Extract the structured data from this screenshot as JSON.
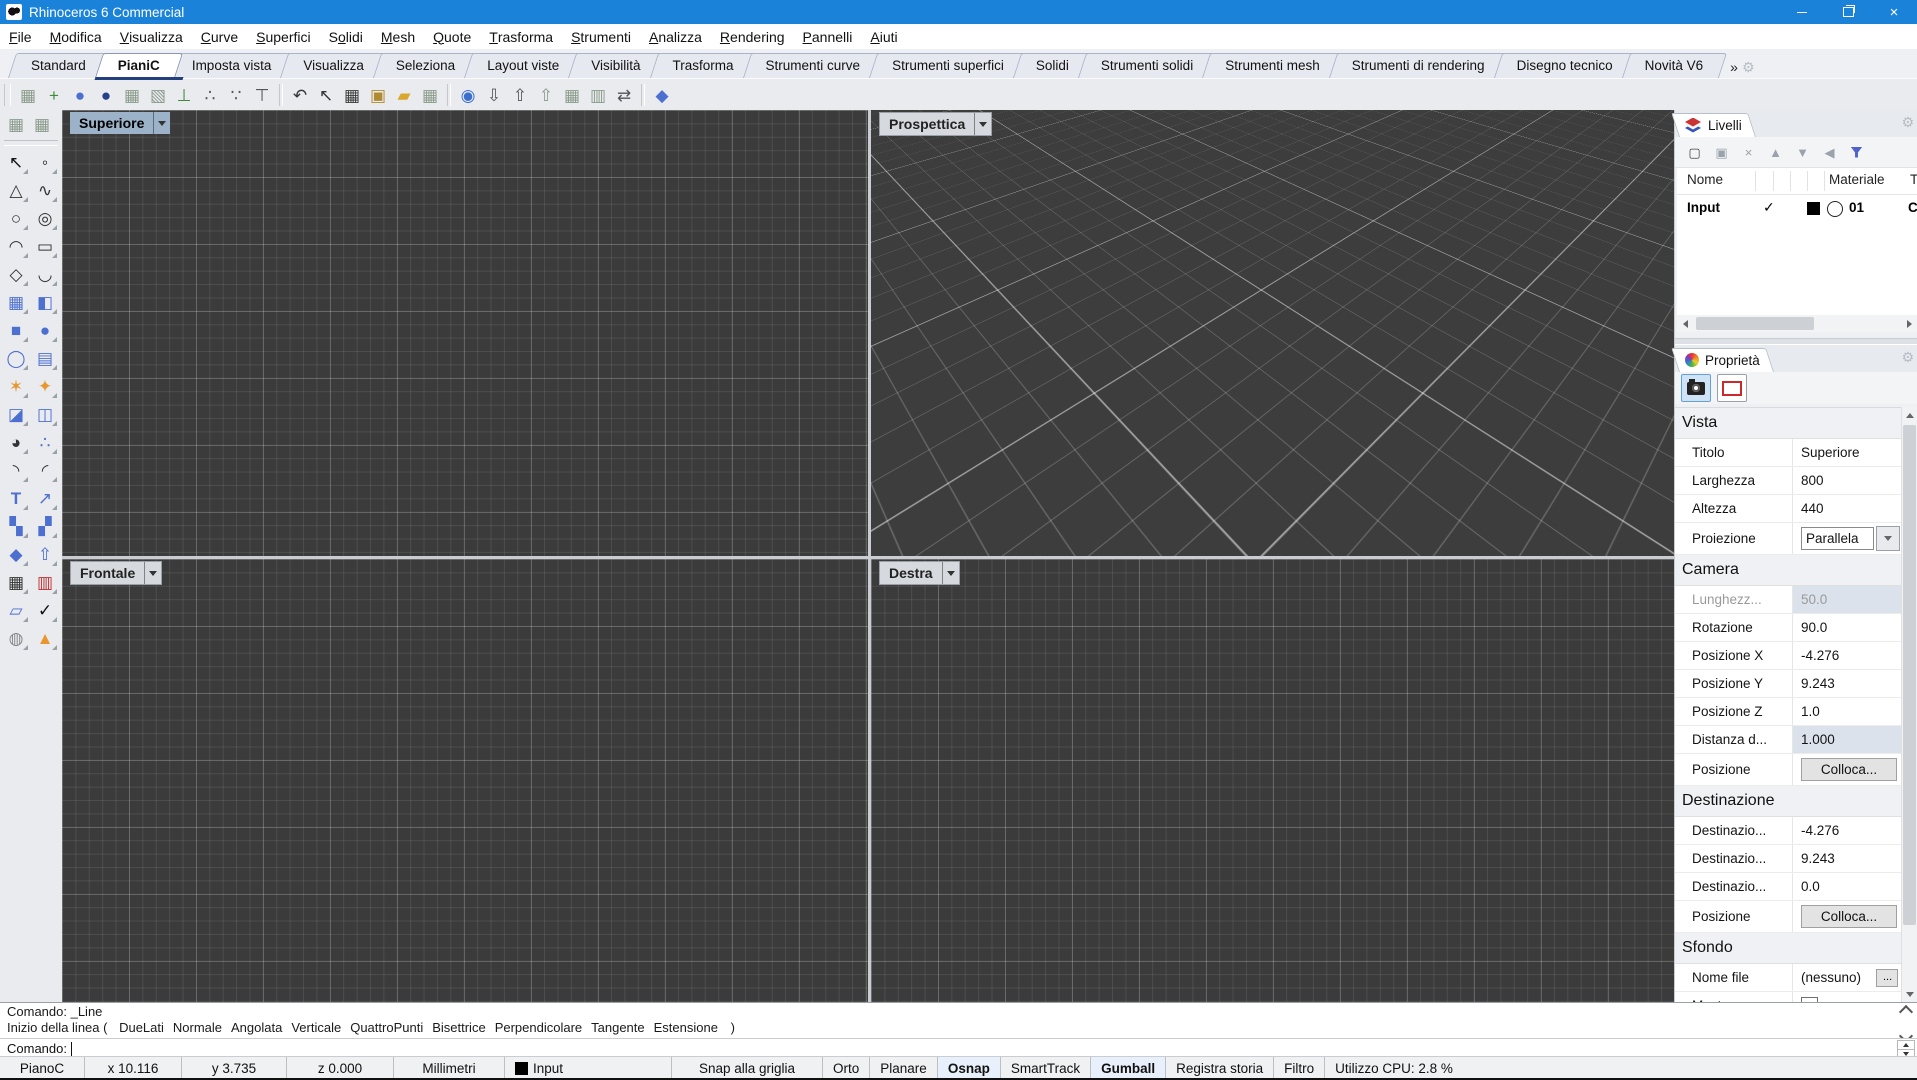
{
  "colors": {
    "titlebar": "#1a83d9",
    "viewport_bg": "#3b3b3b",
    "active_viewport_label": "#9cb2c8",
    "accent_filter": "#4e62c9"
  },
  "window": {
    "title": "Rhinoceros 6 Commercial"
  },
  "menu": {
    "items": [
      {
        "pre": "",
        "key": "F",
        "post": "ile"
      },
      {
        "pre": "",
        "key": "M",
        "post": "odifica"
      },
      {
        "pre": "",
        "key": "V",
        "post": "isualizza"
      },
      {
        "pre": "",
        "key": "C",
        "post": "urve"
      },
      {
        "pre": "",
        "key": "S",
        "post": "uperfici"
      },
      {
        "pre": "S",
        "key": "o",
        "post": "lidi"
      },
      {
        "pre": "",
        "key": "M",
        "post": "esh"
      },
      {
        "pre": "",
        "key": "Q",
        "post": "uote"
      },
      {
        "pre": "",
        "key": "T",
        "post": "rasforma"
      },
      {
        "pre": "",
        "key": "S",
        "post": "trumenti"
      },
      {
        "pre": "",
        "key": "A",
        "post": "nalizza"
      },
      {
        "pre": "",
        "key": "R",
        "post": "endering"
      },
      {
        "pre": "",
        "key": "P",
        "post": "annelli"
      },
      {
        "pre": "",
        "key": "A",
        "post": "iuti"
      }
    ]
  },
  "tabs": {
    "active": "PianiC",
    "overflow": "»",
    "items": [
      "Standard",
      "PianiC",
      "Imposta vista",
      "Visualizza",
      "Seleziona",
      "Layout viste",
      "Visibilità",
      "Trasforma",
      "Strumenti curve",
      "Strumenti superfici",
      "Solidi",
      "Strumenti solidi",
      "Strumenti mesh",
      "Strumenti di rendering",
      "Disegno tecnico",
      "Novità V6"
    ]
  },
  "toolbar": {
    "items": [
      {
        "n": "cplane-world-icon",
        "g": "▦",
        "c": "#8a9a8a"
      },
      {
        "n": "cplane-origin-icon",
        "g": "+",
        "c": "#3f8a3f"
      },
      {
        "n": "cplane-sphere-icon",
        "g": "●",
        "c": "#4d6fd0"
      },
      {
        "n": "cplane-sphere-dark-icon",
        "g": "●",
        "c": "#27408b"
      },
      {
        "n": "cplane-object-icon",
        "g": "▦",
        "c": "#8a9a8a"
      },
      {
        "n": "cplane-rotate-icon",
        "g": "▧",
        "c": "#8a9a8a"
      },
      {
        "n": "cplane-zaxis-icon",
        "g": "⊥",
        "c": "#3f8a3f"
      },
      {
        "n": "cplane-3point-icon",
        "g": "∴",
        "c": "#555555"
      },
      {
        "n": "cplane-points-icon",
        "g": "∵",
        "c": "#555555"
      },
      {
        "n": "cplane-elevation-icon",
        "g": "⊤",
        "c": "#555555"
      },
      {
        "sep": true
      },
      {
        "n": "undo-cplane-icon",
        "g": "↶",
        "c": "#333333"
      },
      {
        "n": "select-cursor-icon",
        "g": "↖",
        "c": "#333333"
      },
      {
        "n": "grid-settings-icon",
        "g": "▦",
        "c": "#3a3a3a"
      },
      {
        "n": "save-cplane-icon",
        "g": "▣",
        "c": "#b08a30"
      },
      {
        "n": "open-folder-icon",
        "g": "▰",
        "c": "#d9a62e"
      },
      {
        "n": "cplane-import-icon",
        "g": "▦",
        "c": "#8a9a8a"
      },
      {
        "sep": true
      },
      {
        "n": "show-eye-icon",
        "g": "◉",
        "c": "#3a6fd0"
      },
      {
        "n": "cplane-down-icon",
        "g": "⇩",
        "c": "#555555"
      },
      {
        "n": "cplane-up-icon",
        "g": "⇧",
        "c": "#555555"
      },
      {
        "n": "cplane-raise-icon",
        "g": "⇧",
        "c": "#8a9a8a"
      },
      {
        "n": "cplane-next-icon",
        "g": "▦",
        "c": "#8a9a8a"
      },
      {
        "n": "cplane-previous-icon",
        "g": "▥",
        "c": "#8a9a8a"
      },
      {
        "n": "cplane-swap-icon",
        "g": "⇄",
        "c": "#555555"
      },
      {
        "sep": true
      },
      {
        "n": "polyhedron-icon",
        "g": "◆",
        "c": "#4d6fd0"
      }
    ]
  },
  "sidebar": {
    "top": [
      {
        "n": "cplane-dock-icon-1",
        "g": "▦",
        "c": "#8a9a8a"
      },
      {
        "n": "cplane-dock-icon-2",
        "g": "▦",
        "c": "#8a9a8a"
      }
    ],
    "items": [
      {
        "n": "select-arrow-icon",
        "g": "↖",
        "c": "#111111"
      },
      {
        "n": "point-icon",
        "g": "◦",
        "c": "#111111"
      },
      {
        "n": "control-point-curve-icon",
        "g": "△",
        "c": "#333333"
      },
      {
        "n": "curve-icon",
        "g": "∿",
        "c": "#333333"
      },
      {
        "n": "circle-icon",
        "g": "○",
        "c": "#333333"
      },
      {
        "n": "ellipse-icon",
        "g": "◎",
        "c": "#333333"
      },
      {
        "n": "arc-icon",
        "g": "◠",
        "c": "#333333"
      },
      {
        "n": "rectangle-icon",
        "g": "▭",
        "c": "#333333"
      },
      {
        "n": "polygon-icon",
        "g": "◇",
        "c": "#333333"
      },
      {
        "n": "fillet-curve-icon",
        "g": "◡",
        "c": "#333333"
      },
      {
        "n": "surface-points-icon",
        "g": "▦",
        "c": "#4d6fd0"
      },
      {
        "n": "loft-surface-icon",
        "g": "◧",
        "c": "#4d6fd0"
      },
      {
        "n": "box-icon",
        "g": "■",
        "c": "#4d6fd0"
      },
      {
        "n": "sphere-icon",
        "g": "●",
        "c": "#4d6fd0"
      },
      {
        "n": "torus-icon",
        "g": "◯",
        "c": "#4d6fd0"
      },
      {
        "n": "surface-grid-icon",
        "g": "▤",
        "c": "#4d6fd0"
      },
      {
        "n": "explode-icon",
        "g": "✶",
        "c": "#e8962e"
      },
      {
        "n": "boom-icon",
        "g": "✦",
        "c": "#e8962e"
      },
      {
        "n": "trim-icon",
        "g": "◪",
        "c": "#4d6fd0"
      },
      {
        "n": "split-icon",
        "g": "◫",
        "c": "#4d6fd0"
      },
      {
        "n": "blend-colors-icon",
        "g": "◕",
        "c": "#333333"
      },
      {
        "n": "point-group-icon",
        "g": "∴",
        "c": "#4d6fd0"
      },
      {
        "n": "fillet-icon",
        "g": "◝",
        "c": "#333333"
      },
      {
        "n": "blend-curve-icon",
        "g": "◜",
        "c": "#333333"
      },
      {
        "n": "text-icon",
        "g": "T",
        "c": "#4d6fd0"
      },
      {
        "n": "scale-icon",
        "g": "↗",
        "c": "#4d6fd0"
      },
      {
        "n": "arrange-icon",
        "g": "▚",
        "c": "#4d6fd0"
      },
      {
        "n": "rotate-rect-icon",
        "g": "▞",
        "c": "#4d6fd0"
      },
      {
        "n": "solid-union-icon",
        "g": "◆",
        "c": "#4d6fd0"
      },
      {
        "n": "extrude-icon",
        "g": "⇧",
        "c": "#4d6fd0"
      },
      {
        "n": "array-grid-icon",
        "g": "▦",
        "c": "#333333"
      },
      {
        "n": "distribute-icon",
        "g": "▥",
        "c": "#c03030"
      },
      {
        "n": "layout-icon",
        "g": "▱",
        "c": "#4d6fd0"
      },
      {
        "n": "check-icon",
        "g": "✓",
        "c": "#111111"
      },
      {
        "n": "cylinder-cone-icon",
        "g": "◍",
        "c": "#888888"
      },
      {
        "n": "cone-icon",
        "g": "▲",
        "c": "#e8962e"
      }
    ]
  },
  "viewports": {
    "top_left": {
      "label": "Superiore",
      "active": true
    },
    "top_right": {
      "label": "Prospettica",
      "active": false
    },
    "bottom_left": {
      "label": "Frontale",
      "active": false
    },
    "bottom_right": {
      "label": "Destra",
      "active": false
    }
  },
  "layers": {
    "title": "Livelli",
    "toolbar": [
      {
        "n": "new-layer-icon",
        "g": "▢",
        "c": "#444444"
      },
      {
        "n": "copy-layer-icon",
        "g": "▣",
        "c": "#9aa2ac"
      },
      {
        "n": "delete-layer-icon",
        "g": "×",
        "c": "#9aa2ac"
      },
      {
        "n": "layer-up-icon",
        "g": "▲",
        "c": "#9aa2ac"
      },
      {
        "n": "layer-down-icon",
        "g": "▼",
        "c": "#9aa2ac"
      },
      {
        "n": "layer-left-icon",
        "g": "◀",
        "c": "#9aa2ac"
      }
    ],
    "columns": [
      "Nome",
      "Materiale",
      "T"
    ],
    "row": {
      "name": "Input",
      "current_mark": "✓",
      "color": "#000000",
      "material": "01",
      "linetype_clipped": "C"
    }
  },
  "properties": {
    "title": "Proprietà",
    "sections": [
      {
        "header": "Vista",
        "rows": [
          {
            "label": "Titolo",
            "value": "Superiore"
          },
          {
            "label": "Larghezza",
            "value": "800"
          },
          {
            "label": "Altezza",
            "value": "440"
          },
          {
            "label": "Proiezione",
            "value": "Parallela",
            "type": "dropdown"
          }
        ]
      },
      {
        "header": "Camera",
        "rows": [
          {
            "label": "Lunghezz...",
            "value": "50.0",
            "disabled": true,
            "shaded": true
          },
          {
            "label": "Rotazione",
            "value": "90.0"
          },
          {
            "label": "Posizione X",
            "value": "-4.276"
          },
          {
            "label": "Posizione Y",
            "value": "9.243"
          },
          {
            "label": "Posizione Z",
            "value": "1.0"
          },
          {
            "label": "Distanza d...",
            "value": "1.000",
            "shaded": true
          },
          {
            "label": "Posizione",
            "value": "Colloca...",
            "type": "button"
          }
        ]
      },
      {
        "header": "Destinazione",
        "rows": [
          {
            "label": "Destinazio...",
            "value": "-4.276"
          },
          {
            "label": "Destinazio...",
            "value": "9.243"
          },
          {
            "label": "Destinazio...",
            "value": "0.0"
          },
          {
            "label": "Posizione",
            "value": "Colloca...",
            "type": "button"
          }
        ]
      },
      {
        "header": "Sfondo",
        "rows": [
          {
            "label": "Nome file",
            "value": "(nessuno)",
            "type": "file",
            "button": "..."
          },
          {
            "label": "Mostra",
            "value": "",
            "type": "checkbox"
          }
        ]
      }
    ]
  },
  "command": {
    "line1": "Comando: _Line",
    "prefix": "Inizio della linea (",
    "options": [
      "DueLati",
      "Normale",
      "Angolata",
      "Verticale",
      "QuattroPunti",
      "Bisettrice",
      "Perpendicolare",
      "Tangente",
      "Estensione"
    ],
    "suffix": ")",
    "prompt": "Comando:"
  },
  "status": {
    "cells": [
      {
        "label": "PianoC"
      },
      {
        "label": "x 10.116"
      },
      {
        "label": "y 3.735"
      },
      {
        "label": "z 0.000"
      },
      {
        "label": "Millimetri"
      },
      {
        "label": "Input",
        "swatch": "#000000"
      },
      {
        "label": "Snap alla griglia"
      },
      {
        "label": "Orto"
      },
      {
        "label": "Planare"
      },
      {
        "label": "Osnap",
        "bold": true,
        "highlight": true
      },
      {
        "label": "SmartTrack"
      },
      {
        "label": "Gumball",
        "bold": true,
        "highlight": true
      },
      {
        "label": "Registra storia"
      },
      {
        "label": "Filtro"
      },
      {
        "label": "Utilizzo CPU: 2.8 %"
      }
    ]
  }
}
